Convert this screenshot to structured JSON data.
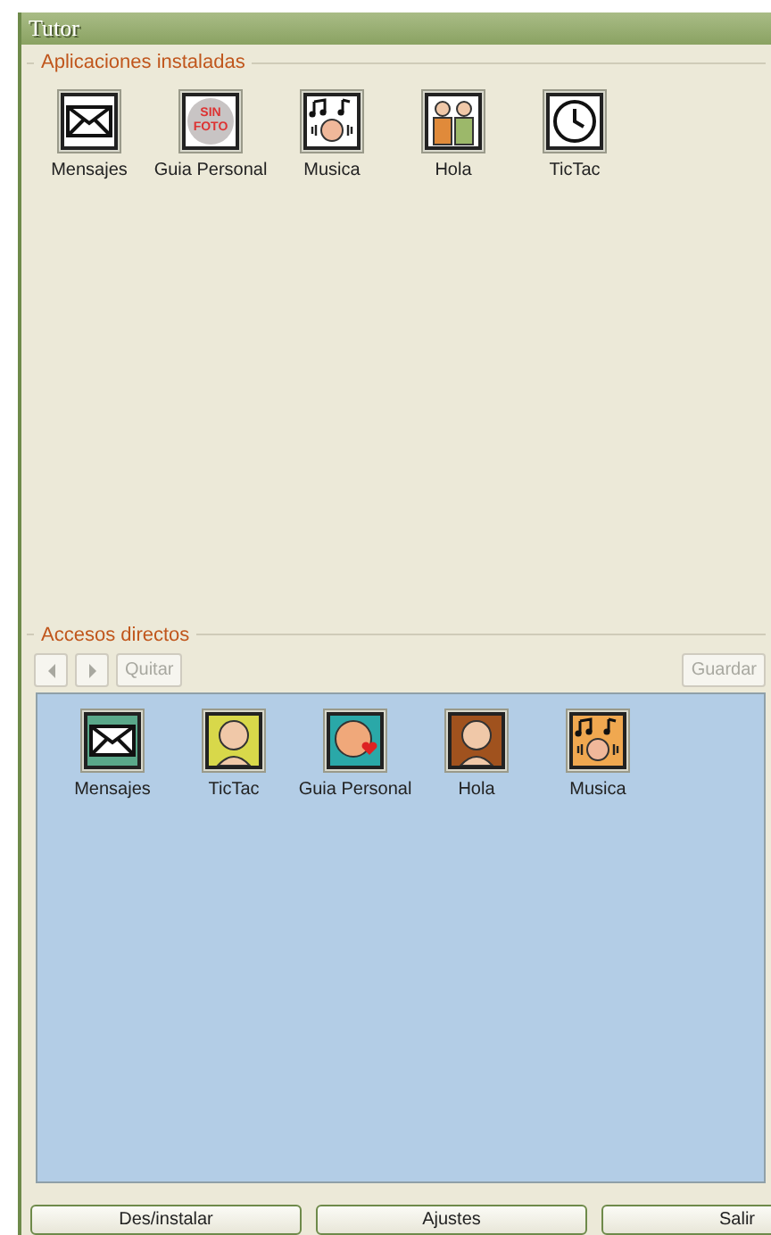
{
  "window": {
    "title": "Tutor"
  },
  "installed": {
    "legend": "Aplicaciones instaladas",
    "apps": [
      {
        "label": "Mensajes",
        "kind": "envelope"
      },
      {
        "label": "Guia Personal",
        "kind": "no-photo",
        "icon_text": "SIN FOTO"
      },
      {
        "label": "Musica",
        "kind": "music"
      },
      {
        "label": "Hola",
        "kind": "people"
      },
      {
        "label": "TicTac",
        "kind": "clock"
      }
    ]
  },
  "shortcuts": {
    "legend": "Accesos directos",
    "toolbar": [
      {
        "kind": "prev",
        "disabled": true
      },
      {
        "kind": "next",
        "disabled": true
      },
      {
        "kind": "text",
        "label": "Quitar",
        "disabled": true
      },
      {
        "kind": "spacer"
      },
      {
        "kind": "text",
        "label": "Guardar",
        "disabled": true
      }
    ],
    "apps": [
      {
        "label": "Mensajes",
        "kind": "envelope",
        "color": "#5aa88a"
      },
      {
        "label": "TicTac",
        "kind": "person",
        "color": "#d8d84a"
      },
      {
        "label": "Guia Personal",
        "kind": "heart-person",
        "color": "#2aa8a8"
      },
      {
        "label": "Hola",
        "kind": "person",
        "color": "#a0521e"
      },
      {
        "label": "Musica",
        "kind": "music",
        "color": "#f0a850"
      }
    ]
  },
  "buttons": [
    "Des/instalar",
    "Ajustes",
    "Salir"
  ]
}
